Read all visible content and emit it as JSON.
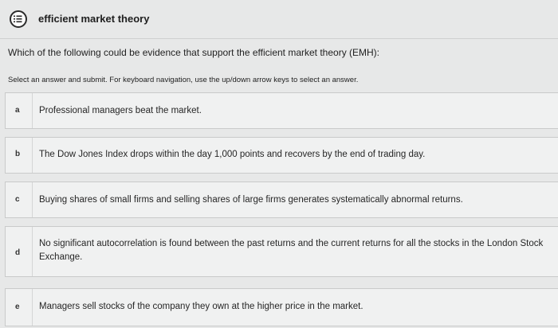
{
  "header": {
    "icon": "list-icon",
    "title": "efficient market theory"
  },
  "question": {
    "text": "Which of the following could be evidence that support the efficient market theory (EMH):",
    "instructions": "Select an answer and submit. For keyboard navigation, use the up/down arrow keys to select an answer."
  },
  "options": [
    {
      "letter": "a",
      "text": "Professional managers beat the market."
    },
    {
      "letter": "b",
      "text": "The Dow Jones Index drops within the day 1,000 points and recovers by the end of trading day."
    },
    {
      "letter": "c",
      "text": "Buying shares of small firms and selling shares of large firms generates systematically abnormal returns."
    },
    {
      "letter": "d",
      "text": "No significant autocorrelation is found between the past returns and the current returns for all the stocks in the London Stock Exchange."
    },
    {
      "letter": "e",
      "text": "Managers sell stocks of the company they own at the higher price in the market."
    }
  ]
}
